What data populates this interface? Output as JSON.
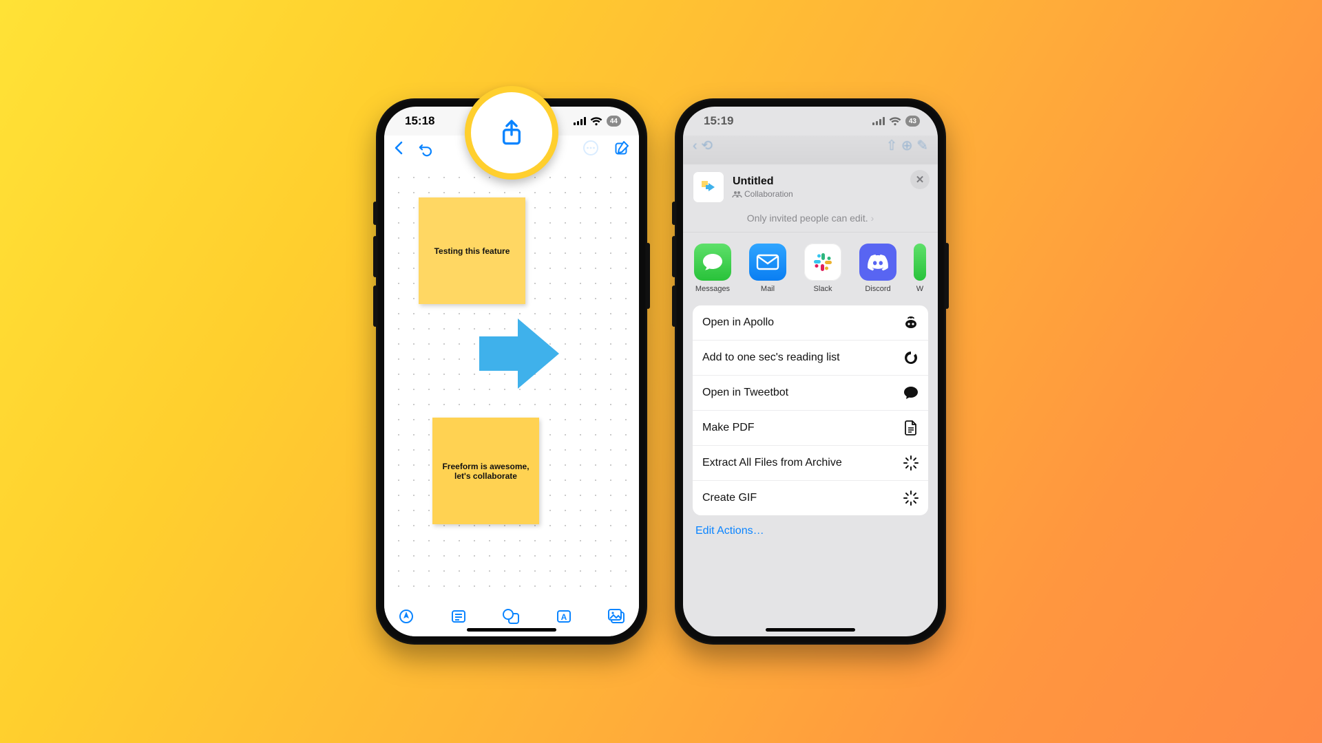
{
  "phone1": {
    "time": "15:18",
    "battery": "44",
    "sticky1": "Testing this feature",
    "sticky2": "Freeform is awesome, let's collaborate"
  },
  "phone2": {
    "time": "15:19",
    "battery": "43",
    "doc_title": "Untitled",
    "doc_mode": "Collaboration",
    "permission": "Only invited people can edit.",
    "apps": {
      "messages": "Messages",
      "mail": "Mail",
      "slack": "Slack",
      "discord": "Discord",
      "partial": "W"
    },
    "actions": {
      "apollo": "Open in Apollo",
      "onesec": "Add to one sec's reading list",
      "tweetbot": "Open in Tweetbot",
      "makepdf": "Make PDF",
      "extract": "Extract All Files from Archive",
      "gif": "Create GIF"
    },
    "edit_actions": "Edit Actions…"
  }
}
